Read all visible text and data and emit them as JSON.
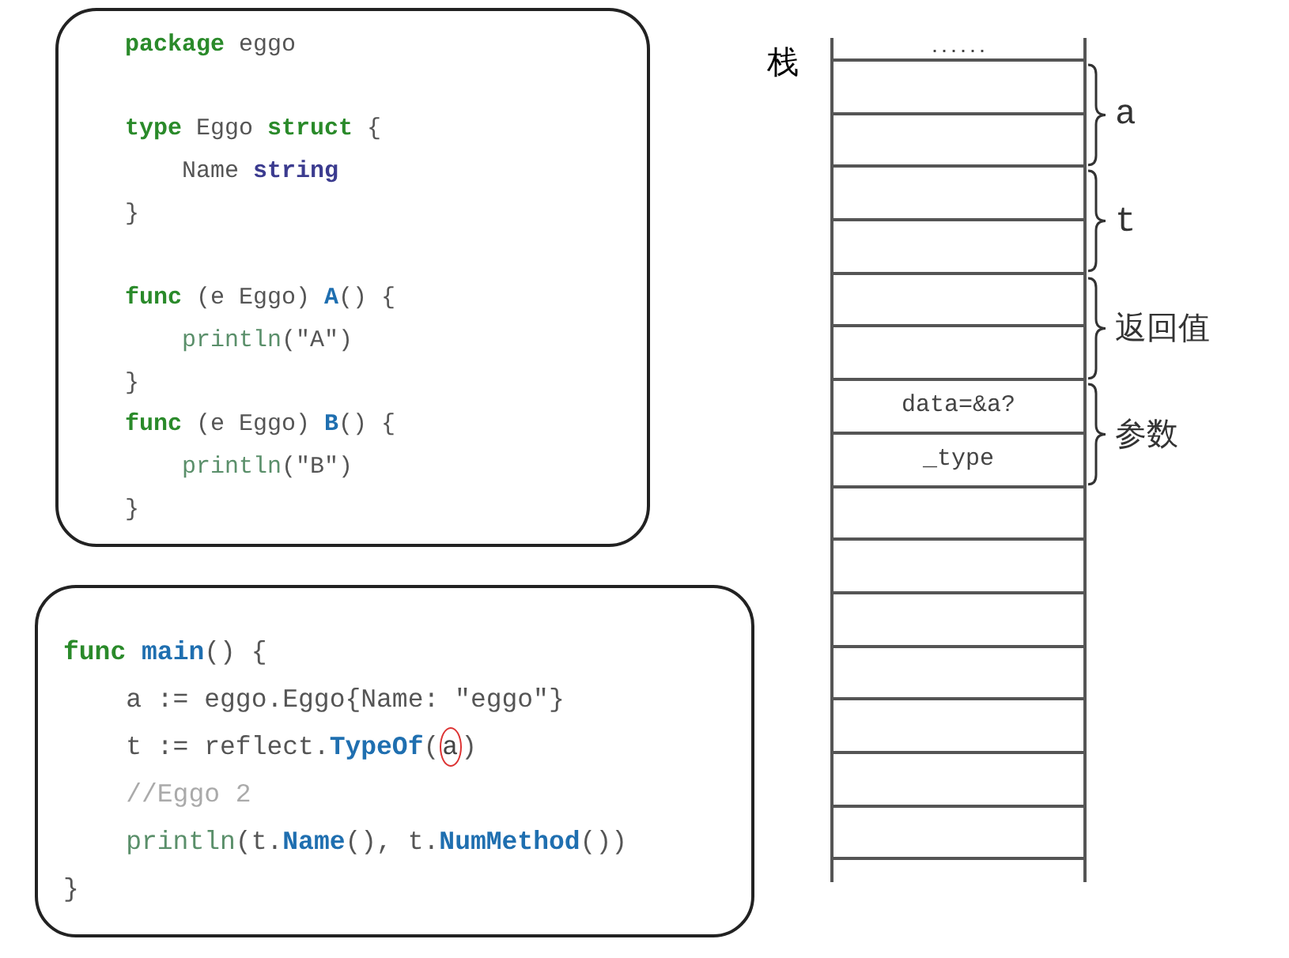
{
  "package_code": {
    "lines": [
      {
        "gap_before": false,
        "tokens": [
          {
            "t": "package",
            "kind": "keyword"
          },
          {
            "t": " eggo",
            "kind": "plain"
          }
        ]
      },
      {
        "gap_before": true,
        "tokens": [
          {
            "t": "type",
            "kind": "keyword"
          },
          {
            "t": " Eggo ",
            "kind": "plain"
          },
          {
            "t": "struct",
            "kind": "keyword"
          },
          {
            "t": " {",
            "kind": "plain"
          }
        ]
      },
      {
        "gap_before": false,
        "tokens": [
          {
            "t": "    Name ",
            "kind": "plain"
          },
          {
            "t": "string",
            "kind": "type"
          }
        ]
      },
      {
        "gap_before": false,
        "tokens": [
          {
            "t": "}",
            "kind": "plain"
          }
        ]
      },
      {
        "gap_before": true,
        "tokens": [
          {
            "t": "func",
            "kind": "keyword"
          },
          {
            "t": " (e Eggo) ",
            "kind": "plain"
          },
          {
            "t": "A",
            "kind": "name"
          },
          {
            "t": "() {",
            "kind": "plain"
          }
        ]
      },
      {
        "gap_before": false,
        "tokens": [
          {
            "t": "    println",
            "kind": "builtin"
          },
          {
            "t": "(\"A\")",
            "kind": "plain"
          }
        ]
      },
      {
        "gap_before": false,
        "tokens": [
          {
            "t": "}",
            "kind": "plain"
          }
        ]
      },
      {
        "gap_before": false,
        "tokens": [
          {
            "t": "func",
            "kind": "keyword"
          },
          {
            "t": " (e Eggo) ",
            "kind": "plain"
          },
          {
            "t": "B",
            "kind": "name"
          },
          {
            "t": "() {",
            "kind": "plain"
          }
        ]
      },
      {
        "gap_before": false,
        "tokens": [
          {
            "t": "    println",
            "kind": "builtin"
          },
          {
            "t": "(\"B\")",
            "kind": "plain"
          }
        ]
      },
      {
        "gap_before": false,
        "tokens": [
          {
            "t": "}",
            "kind": "plain"
          }
        ]
      }
    ]
  },
  "main_code": {
    "lines": [
      {
        "gap_before": false,
        "tokens": [
          {
            "t": "func ",
            "kind": "keyword"
          },
          {
            "t": "main",
            "kind": "name"
          },
          {
            "t": "() {",
            "kind": "plain"
          }
        ]
      },
      {
        "gap_before": false,
        "tokens": [
          {
            "t": "    a := eggo.Eggo{Name: \"eggo\"}",
            "kind": "plain"
          }
        ]
      },
      {
        "gap_before": false,
        "tokens": [
          {
            "t": "    t := reflect.",
            "kind": "plain"
          },
          {
            "t": "TypeOf",
            "kind": "name"
          },
          {
            "t": "(",
            "kind": "plain"
          },
          {
            "t": "a",
            "kind": "circled"
          },
          {
            "t": ")",
            "kind": "plain"
          }
        ]
      },
      {
        "gap_before": false,
        "tokens": [
          {
            "t": "    //Eggo 2",
            "kind": "comment"
          }
        ]
      },
      {
        "gap_before": false,
        "tokens": [
          {
            "t": "    println",
            "kind": "builtin"
          },
          {
            "t": "(t.",
            "kind": "plain"
          },
          {
            "t": "Name",
            "kind": "name"
          },
          {
            "t": "(), t.",
            "kind": "plain"
          },
          {
            "t": "NumMethod",
            "kind": "name"
          },
          {
            "t": "())",
            "kind": "plain"
          }
        ]
      },
      {
        "gap_before": false,
        "tokens": [
          {
            "t": "}",
            "kind": "plain"
          }
        ]
      }
    ]
  },
  "stack": {
    "label": "栈",
    "cells": [
      {
        "kind": "ellipsis",
        "text": "......"
      },
      {
        "kind": "blank"
      },
      {
        "kind": "blank"
      },
      {
        "kind": "blank"
      },
      {
        "kind": "blank"
      },
      {
        "kind": "blank"
      },
      {
        "kind": "blank"
      },
      {
        "kind": "text",
        "text": "data=&a?"
      },
      {
        "kind": "text",
        "text": "_type"
      },
      {
        "kind": "blank"
      },
      {
        "kind": "blank"
      },
      {
        "kind": "blank"
      },
      {
        "kind": "blank"
      },
      {
        "kind": "blank"
      },
      {
        "kind": "blank"
      },
      {
        "kind": "blank"
      }
    ],
    "groups": [
      {
        "label": "a"
      },
      {
        "label": "t"
      },
      {
        "label": "返回值"
      },
      {
        "label": "参数"
      }
    ]
  }
}
